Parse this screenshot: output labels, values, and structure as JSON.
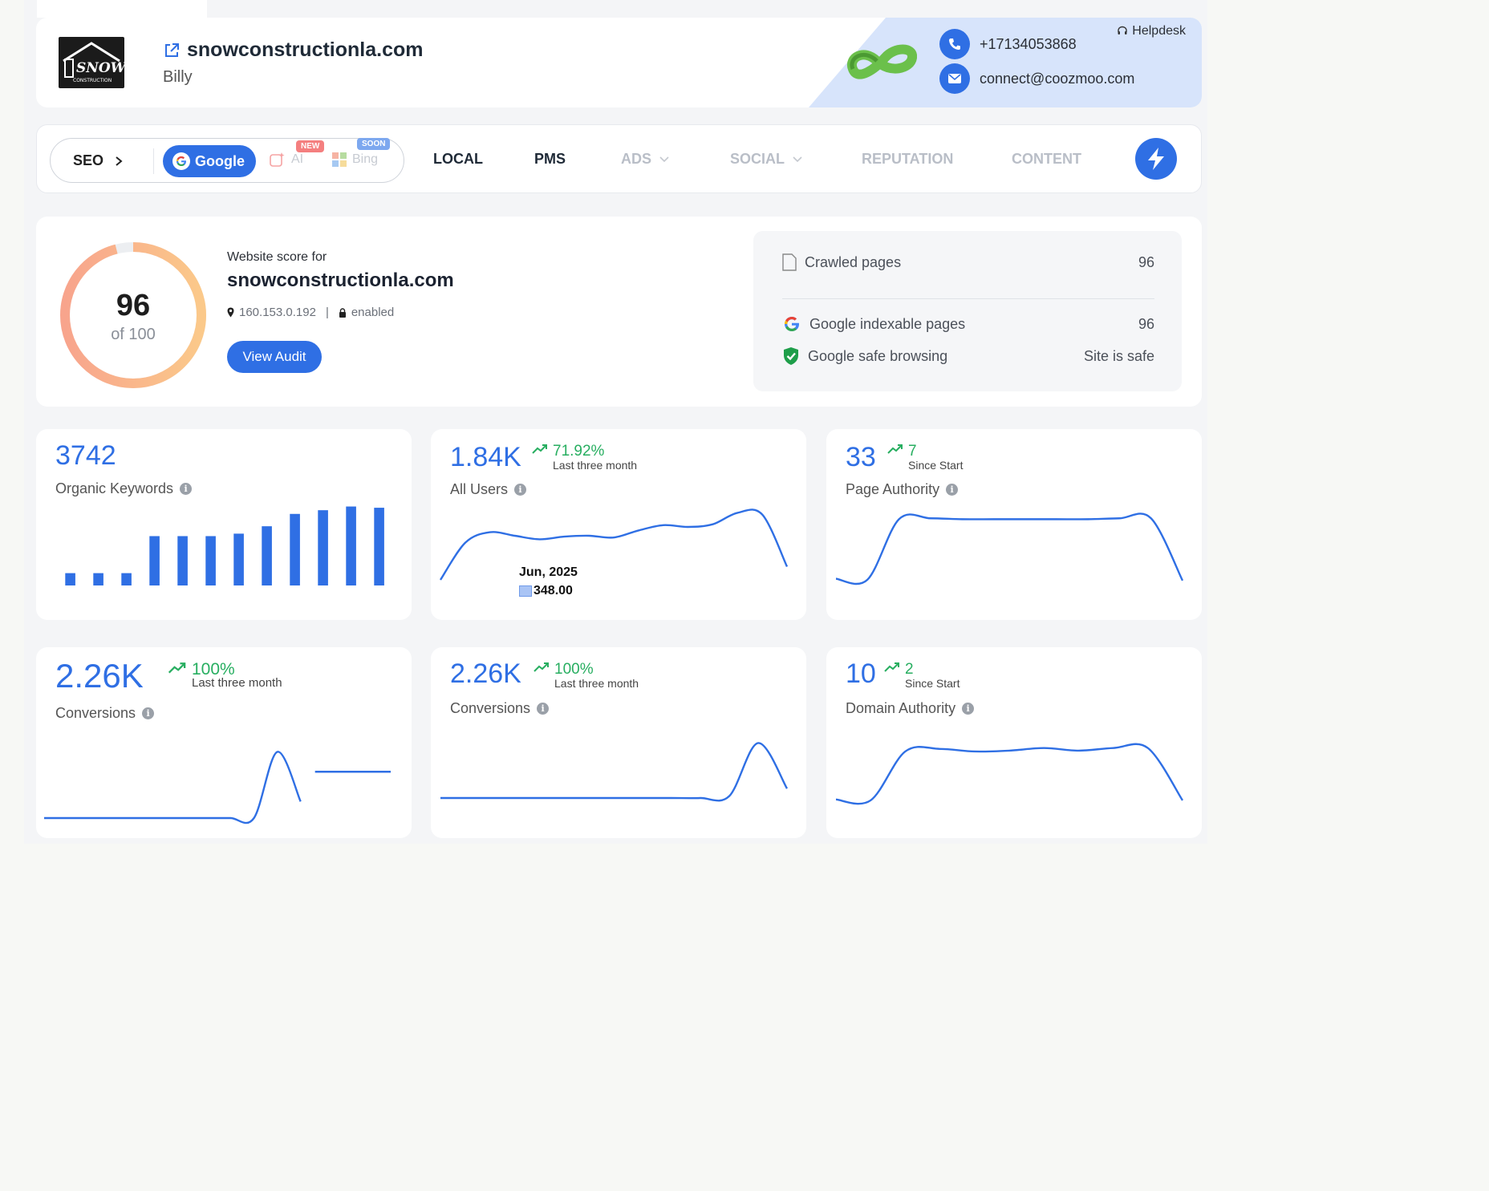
{
  "header": {
    "domain": "snowconstructionla.com",
    "owner": "Billy",
    "logo_text": "SNOW",
    "logo_sub": "CONSTRUCTION",
    "phone": "+17134053868",
    "email": "connect@coozmoo.com",
    "helpdesk": "Helpdesk"
  },
  "nav": {
    "seo": "SEO",
    "google": "Google",
    "ai": "AI",
    "ai_tag": "NEW",
    "bing": "Bing",
    "bing_tag": "SOON",
    "items": [
      {
        "label": "LOCAL",
        "active": true,
        "dropdown": false
      },
      {
        "label": "PMS",
        "active": true,
        "dropdown": false
      },
      {
        "label": "ADS",
        "active": false,
        "dropdown": true
      },
      {
        "label": "SOCIAL",
        "active": false,
        "dropdown": true
      },
      {
        "label": "REPUTATION",
        "active": false,
        "dropdown": false
      },
      {
        "label": "CONTENT",
        "active": false,
        "dropdown": false
      }
    ]
  },
  "score": {
    "value": "96",
    "of": "of 100",
    "percent": 96,
    "label": "Website score for",
    "domain": "snowconstructionla.com",
    "ip": "160.153.0.192",
    "separator": "|",
    "ssl": "enabled",
    "audit_button": "View Audit"
  },
  "crawl": {
    "crawled_label": "Crawled pages",
    "crawled_value": "96",
    "indexable_label": "Google indexable pages",
    "indexable_value": "96",
    "safe_label": "Google safe browsing",
    "safe_value": "Site is safe"
  },
  "metrics": [
    {
      "value": "3742",
      "label": "Organic Keywords",
      "change": "",
      "period": "",
      "chart": "bar"
    },
    {
      "value": "1.84K",
      "label": "All Users",
      "change": "71.92%",
      "period": "Last three month",
      "chart": "line",
      "tooltip": {
        "date": "Jun, 2025",
        "value": "348.00"
      }
    },
    {
      "value": "33",
      "label": "Page Authority",
      "change": "7",
      "period": "Since Start",
      "chart": "line"
    },
    {
      "value": "2.26K",
      "label": "Conversions",
      "change": "100%",
      "period": "Last three month",
      "chart": "line"
    },
    {
      "value": "2.26K",
      "label": "Conversions",
      "change": "100%",
      "period": "Last three month",
      "chart": "line"
    },
    {
      "value": "10",
      "label": "Domain Authority",
      "change": "2",
      "period": "Since Start",
      "chart": "line"
    }
  ],
  "chart_data": [
    {
      "type": "bar",
      "values": [
        1,
        1,
        1,
        4,
        4,
        4,
        4.2,
        4.8,
        5.8,
        6.1,
        6.4,
        6.3
      ]
    },
    {
      "type": "line",
      "values": [
        0,
        4.2,
        5.4,
        5.0,
        4.6,
        4.9,
        5.0,
        4.8,
        5.6,
        6.2,
        6.0,
        6.3,
        7.6,
        7.4,
        1.5
      ]
    },
    {
      "type": "line",
      "values": [
        0.3,
        0.2,
        6.9,
        7.0,
        6.9,
        6.9,
        6.9,
        6.9,
        6.9,
        7.0,
        7.0,
        0.1
      ]
    },
    {
      "type": "line",
      "values": [
        0,
        0,
        0,
        0,
        0,
        0,
        0,
        0,
        0,
        0,
        6.0,
        1.5
      ],
      "segment": [
        4.2,
        4.2
      ]
    },
    {
      "type": "line",
      "values": [
        0,
        0,
        0,
        0,
        0,
        0,
        0,
        0,
        0,
        0,
        0.2,
        5.8,
        1.0
      ]
    },
    {
      "type": "line",
      "values": [
        0.2,
        0.1,
        5.8,
        6.1,
        5.8,
        5.9,
        6.2,
        5.9,
        6.2,
        6.2,
        0.1
      ]
    }
  ]
}
